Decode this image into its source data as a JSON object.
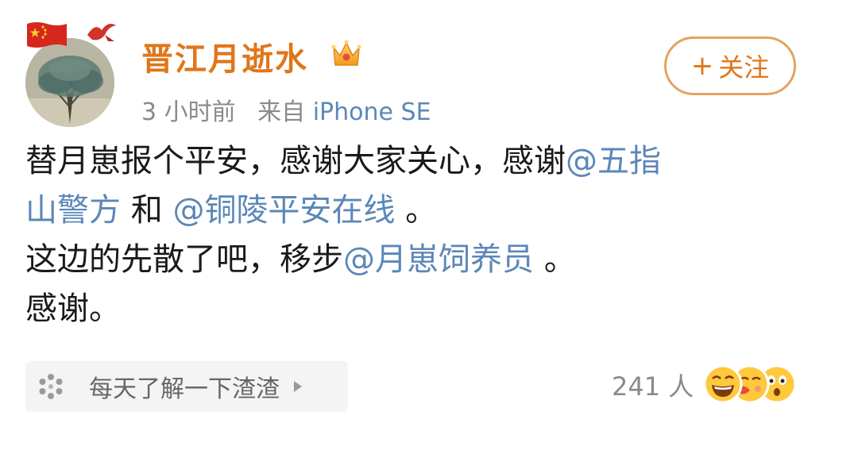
{
  "author": {
    "name": "晋江月逝水",
    "time": "3 小时前",
    "source_prefix": "来自",
    "device": "iPhone SE"
  },
  "follow_button": {
    "plus": "+",
    "label": "关注"
  },
  "post": {
    "line1_text": "替月崽报个平安，感谢大家关心，感谢",
    "line1_mention": "@五指",
    "line2_mention": "山警方",
    "line2_mid": " 和 ",
    "line2_mention2": "@铜陵平安在线",
    "line2_end": " 。",
    "line3_text": "这边的先散了吧，移步",
    "line3_mention": "@月崽饲养员",
    "line3_end": " 。",
    "line4_text": "感谢。"
  },
  "topic": {
    "label": "每天了解一下渣渣"
  },
  "reactions": {
    "count": "241 人"
  },
  "colors": {
    "username": "#e0761a",
    "mention": "#5b87b8",
    "follow_border": "#e5a260",
    "meta": "#8a8a8a"
  },
  "icons": [
    "china-flag-icon",
    "bird-icon",
    "crown-icon",
    "sparkle-icon",
    "arrow-right-icon",
    "laugh-emoji-icon",
    "kiss-emoji-icon",
    "surprised-emoji-icon"
  ]
}
